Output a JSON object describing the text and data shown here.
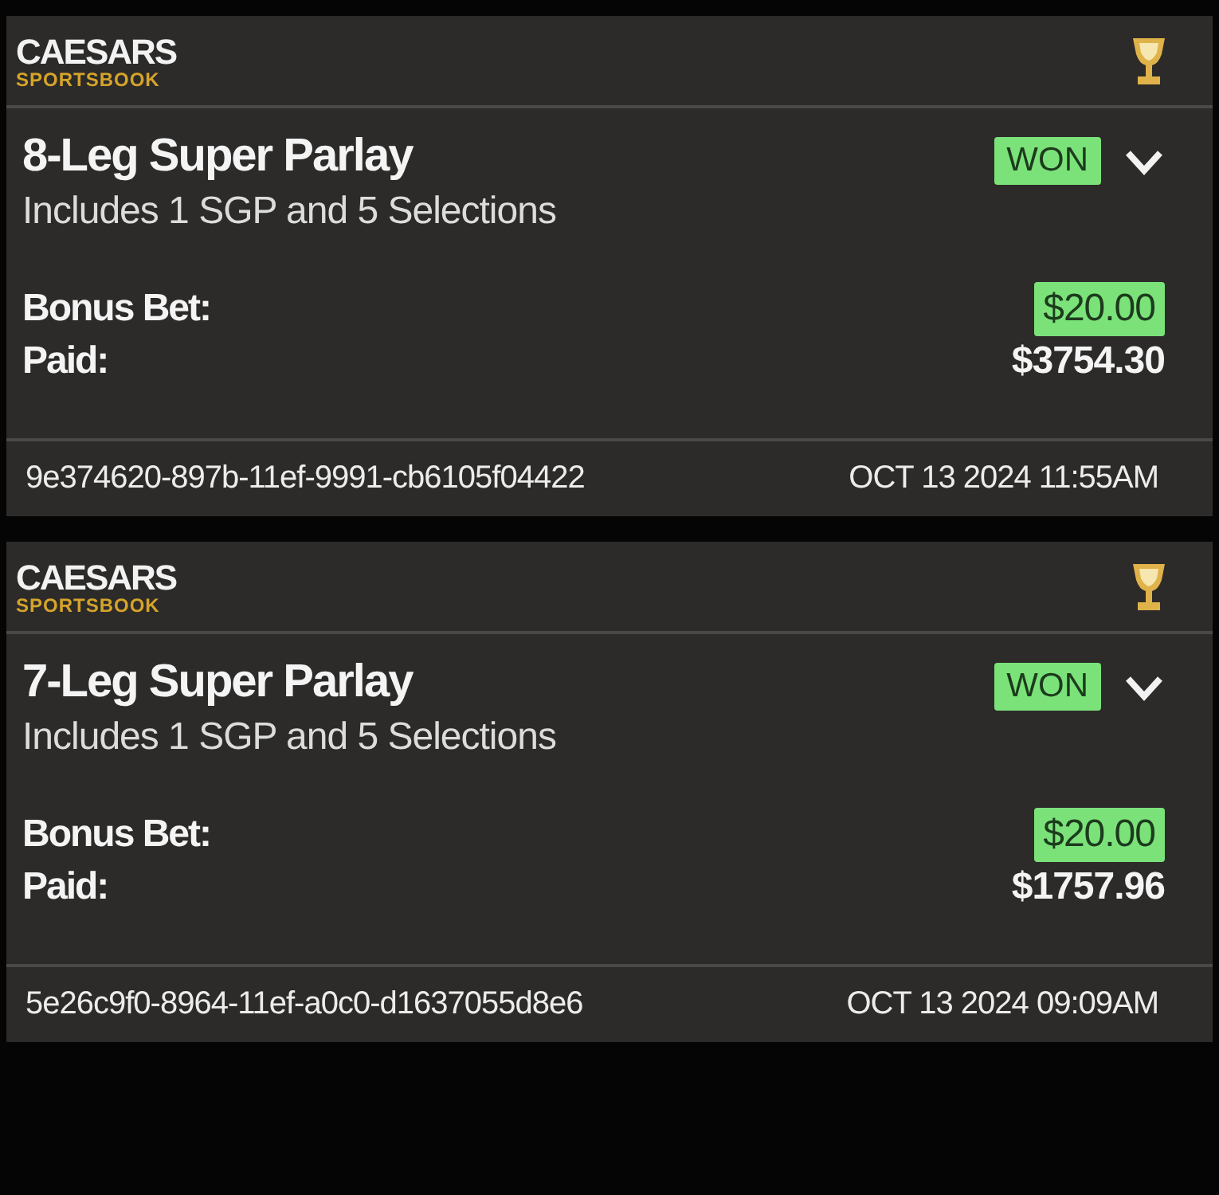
{
  "bets": [
    {
      "brand": {
        "name": "CAESARS",
        "sub": "SPORTSBOOK"
      },
      "title": "8-Leg Super Parlay",
      "subtitle": "Includes 1 SGP and 5 Selections",
      "status": "WON",
      "expanded": false,
      "rows": [
        {
          "label": "Bonus Bet:",
          "value": "$20.00",
          "kind": "badge"
        },
        {
          "label": "Paid:",
          "value": "$3754.30",
          "kind": "plain"
        }
      ],
      "id": "9e374620-897b-11ef-9991-cb6105f04422",
      "date": "OCT 13 2024 11:55AM"
    },
    {
      "brand": {
        "name": "CAESARS",
        "sub": "SPORTSBOOK"
      },
      "title": "7-Leg Super Parlay",
      "subtitle": "Includes 1 SGP and 5 Selections",
      "status": "WON",
      "expanded": false,
      "rows": [
        {
          "label": "Bonus Bet:",
          "value": "$20.00",
          "kind": "badge"
        },
        {
          "label": "Paid:",
          "value": "$1757.96",
          "kind": "plain"
        }
      ],
      "id": "5e26c9f0-8964-11ef-a0c0-d1637055d8e6",
      "date": "OCT 13 2024 09:09AM"
    }
  ]
}
